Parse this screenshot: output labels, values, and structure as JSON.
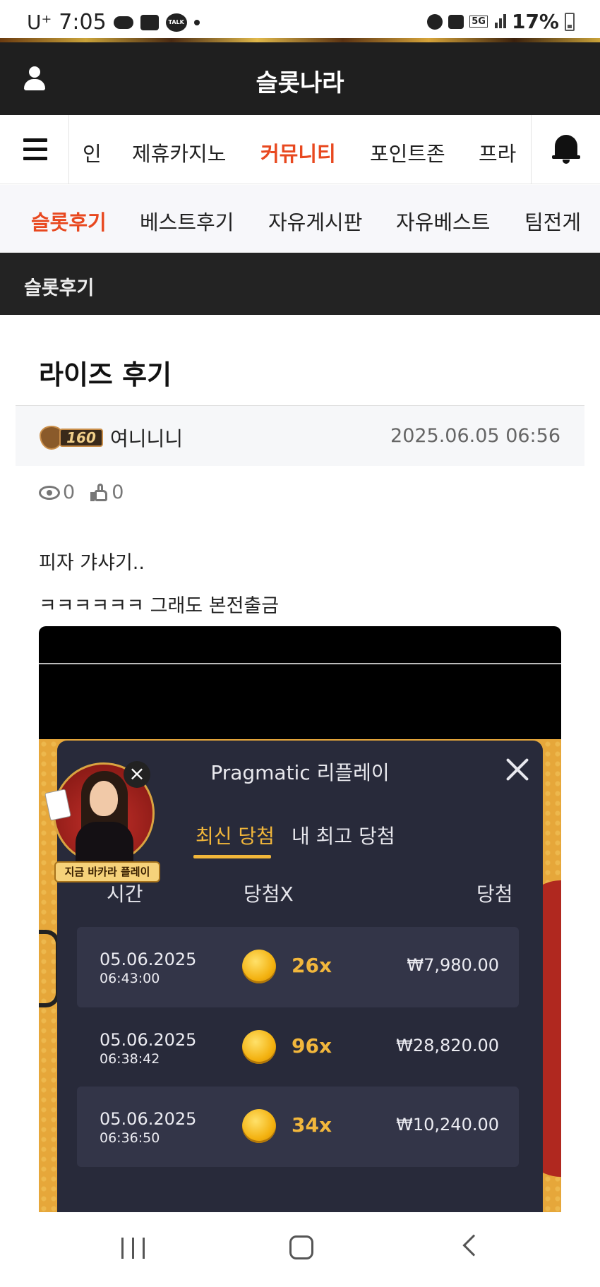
{
  "status_bar": {
    "carrier": "U⁺",
    "time": "7:05",
    "network": "5G",
    "battery": "17%"
  },
  "header": {
    "site_title": "슬롯나라",
    "user_icon": "user-icon"
  },
  "main_nav": {
    "items": [
      {
        "label": "인"
      },
      {
        "label": "제휴카지노"
      },
      {
        "label": "커뮤니티"
      },
      {
        "label": "포인트존"
      },
      {
        "label": "프라"
      }
    ],
    "active_label": "커뮤니티",
    "menu_icon": "hamburger-icon",
    "bell_icon": "bell-icon"
  },
  "sub_nav": {
    "items": [
      {
        "label": "슬롯후기"
      },
      {
        "label": "베스트후기"
      },
      {
        "label": "자유게시판"
      },
      {
        "label": "자유베스트"
      },
      {
        "label": "팀전게"
      }
    ],
    "active_label": "슬롯후기"
  },
  "board": {
    "title": "슬롯후기"
  },
  "post": {
    "title": "라이즈 후기",
    "author_level": "160",
    "author": "여니니니",
    "date": "2025.06.05 06:56",
    "views": "0",
    "likes": "0",
    "body_lines": [
      "피자 갸샤기..",
      "ㅋㅋㅋㅋㅋㅋ 그래도 본전출금"
    ]
  },
  "screenshot": {
    "panel_title": "Pragmatic 리플레이",
    "tabs": [
      {
        "label": "최신 당첨"
      },
      {
        "label": "내 최고 당첨"
      }
    ],
    "active_tab": "최신 당첨",
    "columns": {
      "time": "시간",
      "multiplier": "당첨X",
      "win": "당첨"
    },
    "rows": [
      {
        "date": "05.06.2025",
        "time": "06:43:00",
        "multiplier": "26x",
        "amount": "₩7,980.00"
      },
      {
        "date": "05.06.2025",
        "time": "06:38:42",
        "multiplier": "96x",
        "amount": "₩28,820.00"
      },
      {
        "date": "05.06.2025",
        "time": "06:36:50",
        "multiplier": "34x",
        "amount": "₩10,240.00"
      }
    ],
    "promo_label": "지금 바카라 플레이",
    "promo_close": "×"
  },
  "colors": {
    "accent": "#e8481f",
    "header_bg": "#1f1f1f",
    "panel_bg": "#282a3a",
    "gold": "#f1b63a"
  }
}
